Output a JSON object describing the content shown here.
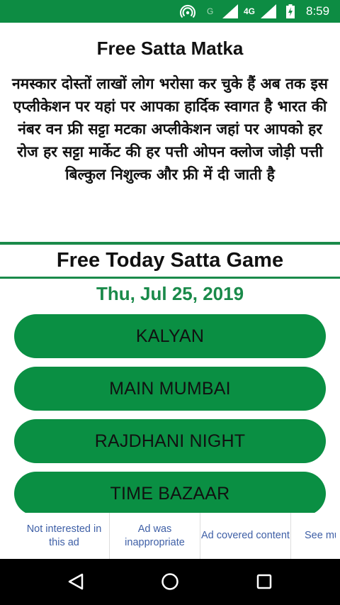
{
  "status_bar": {
    "network_label": "G",
    "network_type": "4G",
    "time": "8:59",
    "icons": [
      "hotspot-icon",
      "signal-icon",
      "signal-icon",
      "battery-charging-icon"
    ]
  },
  "header": {
    "title": "Free Satta Matka"
  },
  "intro": {
    "text": "नमस्कार दोस्तों लाखों लोग भरोसा कर चुके हैं अब तक इस एप्लीकेशन पर यहां पर आपका हार्दिक स्वागत है भारत की नंबर वन फ्री सट्टा मटका अप्लीकेशन जहां पर आपको हर रोज हर सट्टा मार्केट की हर पत्ती ओपन क्लोज जोड़ी पत्ती बिल्कुल निशुल्क और फ्री में दी जाती है"
  },
  "section": {
    "title": "Free Today Satta Game",
    "date": "Thu, Jul 25, 2019"
  },
  "games": [
    {
      "label": "KALYAN"
    },
    {
      "label": "MAIN MUMBAI"
    },
    {
      "label": "RAJDHANI NIGHT"
    },
    {
      "label": "TIME BAZAAR"
    }
  ],
  "ad_feedback": {
    "options": [
      "Not interested in this ad",
      "Ad was inappropriate",
      "Ad covered content",
      "See mult"
    ]
  },
  "colors": {
    "status_bar": "#0d8c43",
    "accent_green": "#1a8a4a",
    "button_green": "#0a8f43",
    "ad_text": "#3e5fa6"
  },
  "navigation": {
    "icons": [
      "back-icon",
      "home-icon",
      "recents-icon"
    ]
  }
}
